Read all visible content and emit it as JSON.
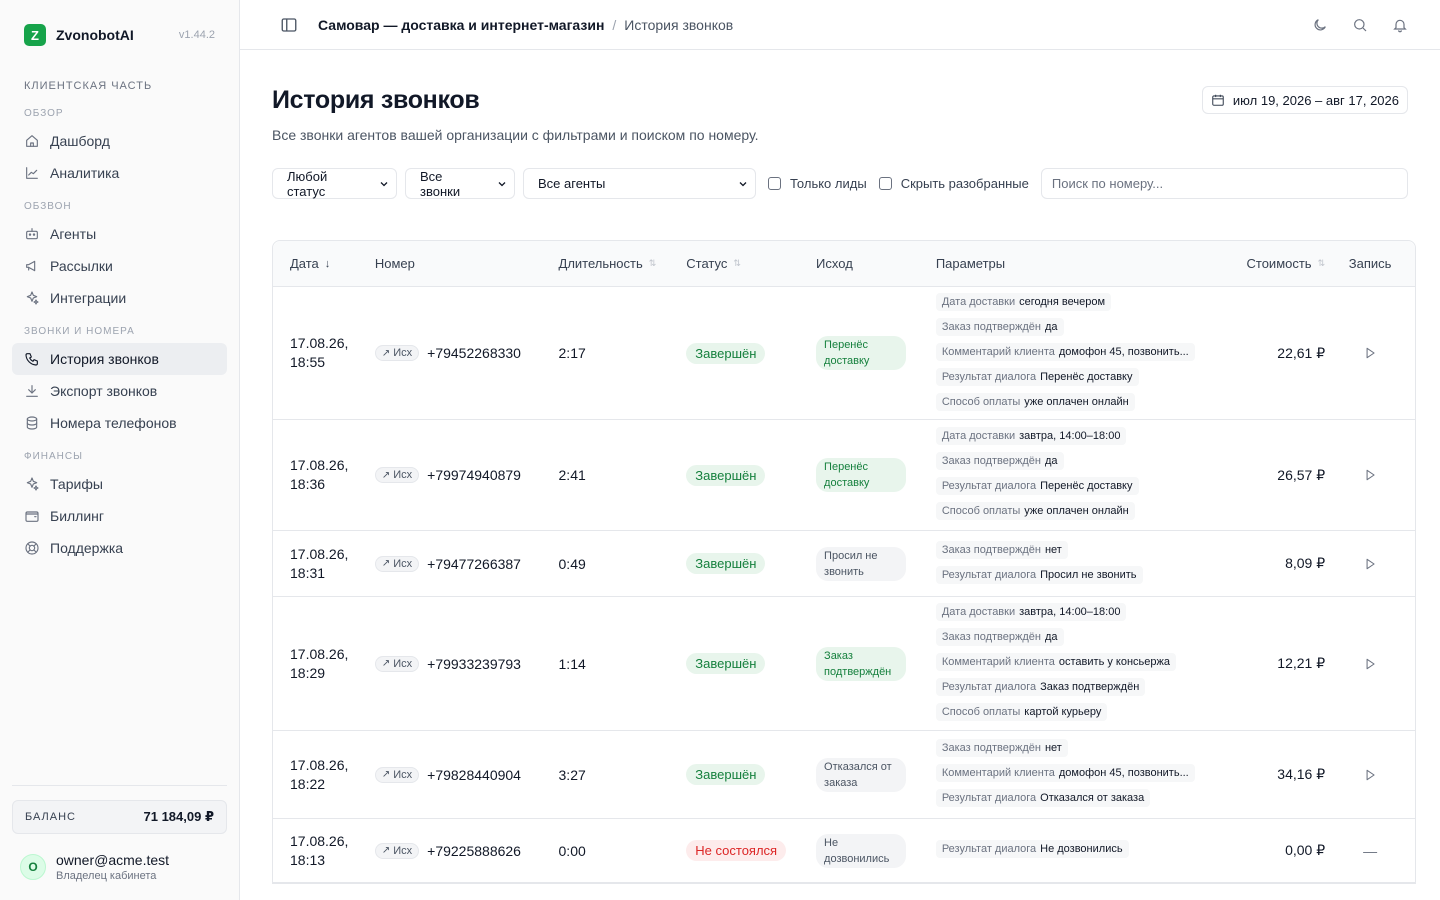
{
  "brand": {
    "logo_letter": "Z",
    "name": "ZvonobotAI",
    "version": "v1.44.2"
  },
  "sidebar": {
    "section_title": "КЛИЕНТСКАЯ ЧАСТЬ",
    "groups": [
      {
        "title": "ОБЗОР",
        "items": [
          {
            "label": "Дашборд",
            "icon": "home-icon"
          },
          {
            "label": "Аналитика",
            "icon": "chart-line-icon"
          }
        ]
      },
      {
        "title": "ОБЗВОН",
        "items": [
          {
            "label": "Агенты",
            "icon": "bot-icon"
          },
          {
            "label": "Рассылки",
            "icon": "megaphone-icon"
          },
          {
            "label": "Интеграции",
            "icon": "sparkles-icon"
          }
        ]
      },
      {
        "title": "ЗВОНКИ И НОМЕРА",
        "items": [
          {
            "label": "История звонков",
            "icon": "phone-icon",
            "active": true
          },
          {
            "label": "Экспорт звонков",
            "icon": "download-icon"
          },
          {
            "label": "Номера телефонов",
            "icon": "database-icon"
          }
        ]
      },
      {
        "title": "ФИНАНСЫ",
        "items": [
          {
            "label": "Тарифы",
            "icon": "sparkles-icon"
          },
          {
            "label": "Биллинг",
            "icon": "wallet-icon"
          },
          {
            "label": "Поддержка",
            "icon": "lifebuoy-icon"
          }
        ]
      }
    ],
    "balance_label": "БАЛАНС",
    "balance_value": "71 184,09 ₽",
    "user": {
      "avatar": "O",
      "email": "owner@acme.test",
      "role": "Владелец кабинета"
    }
  },
  "topbar": {
    "crumb_main": "Самовар — доставка и интернет-магазин",
    "crumb_sep": "/",
    "crumb_current": "История звонков"
  },
  "page": {
    "title": "История звонков",
    "subtitle": "Все звонки агентов вашей организации с фильтрами и поиском по номеру.",
    "date_range": "июл 19, 2026 – авг 17, 2026"
  },
  "filters": {
    "status": "Любой статус",
    "calls": "Все звонки",
    "agents": "Все агенты",
    "only_leads": "Только лиды",
    "hide_processed": "Скрыть разобранные",
    "search_placeholder": "Поиск по номеру..."
  },
  "table": {
    "headers": {
      "date": "Дата",
      "number": "Номер",
      "duration": "Длительность",
      "status": "Статус",
      "outcome": "Исход",
      "params": "Параметры",
      "cost": "Стоимость",
      "record": "Запись"
    },
    "rows": [
      {
        "date1": "17.08.26,",
        "date2": "18:55",
        "dir": "Исх",
        "phone": "+79452268330",
        "duration": "2:17",
        "status": "Завершён",
        "status_ok": true,
        "outcome": "Перенёс доставку",
        "outcome_green": true,
        "params": [
          [
            "Дата доставки",
            "сегодня вечером"
          ],
          [
            "Заказ подтверждён",
            "да"
          ],
          [
            "Комментарий клиента",
            "домофон 45, позвонить..."
          ],
          [
            "Результат диалога",
            "Перенёс доставку"
          ],
          [
            "Способ оплаты",
            "уже оплачен онлайн"
          ]
        ],
        "cost": "22,61 ₽",
        "has_record": true,
        "height": 133
      },
      {
        "date1": "17.08.26,",
        "date2": "18:36",
        "dir": "Исх",
        "phone": "+79974940879",
        "duration": "2:41",
        "status": "Завершён",
        "status_ok": true,
        "outcome": "Перенёс доставку",
        "outcome_green": true,
        "params": [
          [
            "Дата доставки",
            "завтра, 14:00–18:00"
          ],
          [
            "Заказ подтверждён",
            "да"
          ],
          [
            "Результат диалога",
            "Перенёс доставку"
          ],
          [
            "Способ оплаты",
            "уже оплачен онлайн"
          ]
        ],
        "cost": "26,57 ₽",
        "has_record": true,
        "height": 111
      },
      {
        "date1": "17.08.26,",
        "date2": "18:31",
        "dir": "Исх",
        "phone": "+79477266387",
        "duration": "0:49",
        "status": "Завершён",
        "status_ok": true,
        "outcome": "Просил не звонить",
        "outcome_green": false,
        "params": [
          [
            "Заказ подтверждён",
            "нет"
          ],
          [
            "Результат диалога",
            "Просил не звонить"
          ]
        ],
        "cost": "8,09 ₽",
        "has_record": true,
        "height": 66
      },
      {
        "date1": "17.08.26,",
        "date2": "18:29",
        "dir": "Исх",
        "phone": "+79933239793",
        "duration": "1:14",
        "status": "Завершён",
        "status_ok": true,
        "outcome": "Заказ подтверждён",
        "outcome_green": true,
        "params": [
          [
            "Дата доставки",
            "завтра, 14:00–18:00"
          ],
          [
            "Заказ подтверждён",
            "да"
          ],
          [
            "Комментарий клиента",
            "оставить у консьержа"
          ],
          [
            "Результат диалога",
            "Заказ подтверждён"
          ],
          [
            "Способ оплаты",
            "картой курьеру"
          ]
        ],
        "cost": "12,21 ₽",
        "has_record": true,
        "height": 134
      },
      {
        "date1": "17.08.26,",
        "date2": "18:22",
        "dir": "Исх",
        "phone": "+79828440904",
        "duration": "3:27",
        "status": "Завершён",
        "status_ok": true,
        "outcome": "Отказался от заказа",
        "outcome_green": false,
        "params": [
          [
            "Заказ подтверждён",
            "нет"
          ],
          [
            "Комментарий клиента",
            "домофон 45, позвонить..."
          ],
          [
            "Результат диалога",
            "Отказался от заказа"
          ]
        ],
        "cost": "34,16 ₽",
        "has_record": true,
        "height": 88
      },
      {
        "date1": "17.08.26,",
        "date2": "18:13",
        "dir": "Исх",
        "phone": "+79225888626",
        "duration": "0:00",
        "status": "Не состоялся",
        "status_ok": false,
        "outcome": "Не дозвонились",
        "outcome_green": false,
        "params": [
          [
            "Результат диалога",
            "Не дозвонились"
          ]
        ],
        "cost": "0,00 ₽",
        "has_record": false,
        "record_dash": "—",
        "height": 64
      }
    ]
  }
}
